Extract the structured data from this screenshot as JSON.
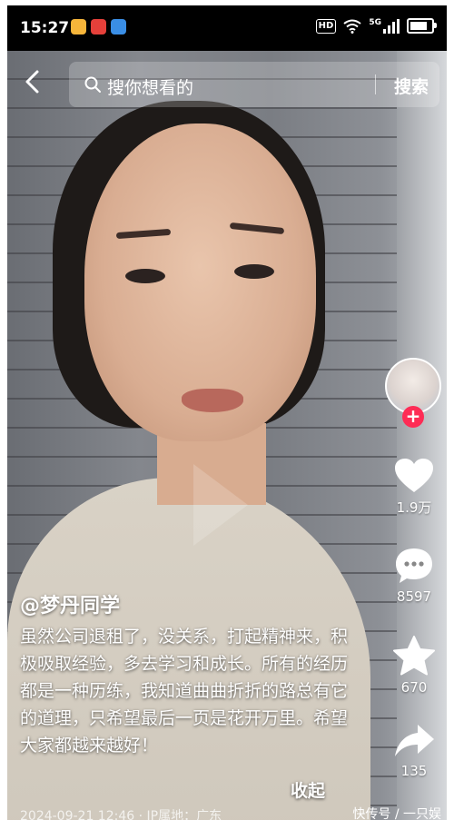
{
  "status_bar": {
    "time": "15:27",
    "hd_label": "HD",
    "network": "5G",
    "notification_icons": [
      "weibo-icon",
      "red-app-icon",
      "blue-app-icon"
    ]
  },
  "search": {
    "placeholder": "搜你想看的",
    "button_label": "搜索"
  },
  "rail": {
    "likes": "1.9万",
    "comments": "8597",
    "favorites": "670",
    "shares": "135"
  },
  "post": {
    "author": "@梦丹同学",
    "caption": "虽然公司退租了，没关系，打起精神来，积极吸取经验，多去学习和成长。所有的经历都是一种历练，我知道曲曲折折的路总有它的道理，只希望最后一页是花开万里。希望大家都越来越好！",
    "collapse_label": "收起",
    "meta": "2024-09-21 12:46 · IP属地：广东"
  },
  "watermark": "快传号 / 一只娱",
  "colors": {
    "accent_red": "#fe2c55",
    "caption_text": "#ffffff"
  }
}
